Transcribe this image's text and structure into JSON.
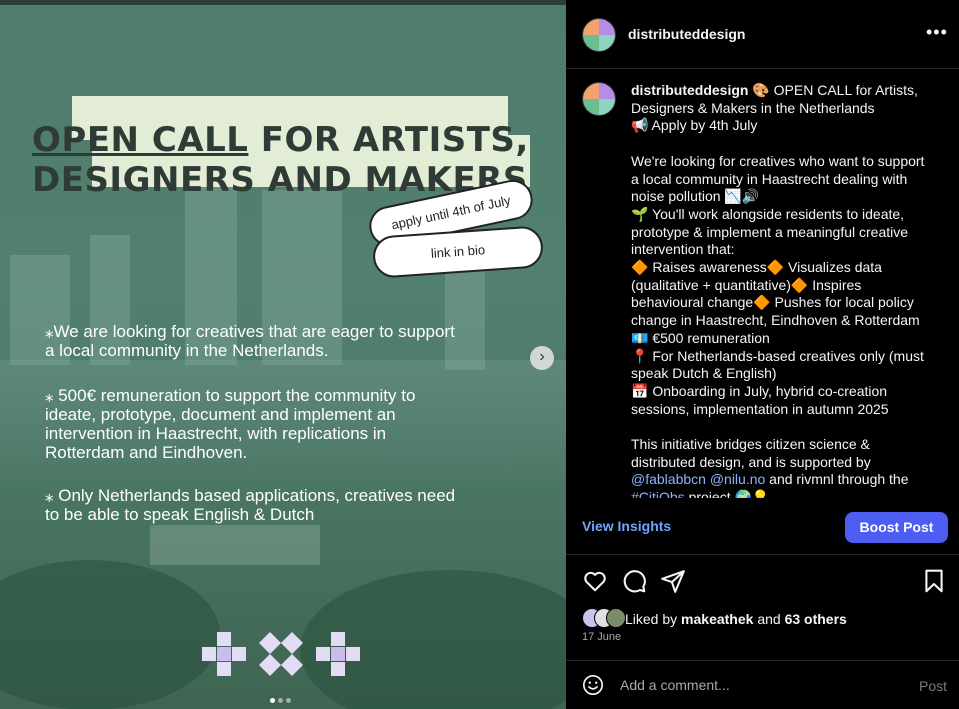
{
  "post": {
    "headline_underlined": "OPEN CALL",
    "headline_rest_line1": " FOR ARTISTS,",
    "headline_line2": "DESIGNERS AND MAKERS",
    "pill_apply": "apply until 4th of July",
    "pill_link": "link in bio",
    "bullets": [
      "⁎We are looking for creatives that are eager to support a local community in the Netherlands.",
      "⁎ 500€ remuneration to support the community to ideate, prototype, document and implement an intervention in Haastrecht, with replications in Rotterdam and Eindhoven.",
      "⁎ Only Netherlands based applications, creatives need to be able to speak English & Dutch"
    ],
    "next_arrow": "›",
    "carousel_count": 3,
    "carousel_active": 1
  },
  "header": {
    "username": "distributeddesign",
    "more": "•••"
  },
  "caption": {
    "username": "distributeddesign",
    "lines": [
      " 🎨 OPEN CALL for Artists, Designers & Makers in the Netherlands",
      "📢 Apply by 4th July",
      "",
      "We're looking for creatives who want to support a local community in Haastrecht dealing with noise pollution 📉🔊",
      "🌱 You'll work alongside residents to ideate, prototype & implement a meaningful creative intervention that:",
      "🔶 Raises awareness🔶 Visualizes data (qualitative + quantitative)🔶 Inspires behavioural change🔶 Pushes for local policy change in Haastrecht, Eindhoven & Rotterdam",
      "💶 €500 remuneration",
      "📍 For Netherlands-based creatives only (must speak Dutch & English)",
      "📅 Onboarding in July, hybrid co-creation sessions, implementation in autumn 2025",
      "",
      "This initiative bridges citizen science & distributed design, and is supported by"
    ],
    "mention1": "@fablabbcn",
    "mention2": "@nilu.no",
    "after_mentions": " and rivmnl through the",
    "hashtag": "#CitiObs",
    "after_hashtag": " project 🌍💡"
  },
  "insights_label": "View Insights",
  "boost_label": "Boost Post",
  "likes": {
    "prefix": "Liked by ",
    "user": "makeathek",
    "middle": " and ",
    "others": "63 others"
  },
  "date": "17 June",
  "comment": {
    "placeholder": "Add a comment...",
    "post_label": "Post"
  },
  "colors": {
    "accent_blue": "#4d5df2",
    "link_blue": "#6ea5ff",
    "headline_bg": "#e3ecd4"
  }
}
